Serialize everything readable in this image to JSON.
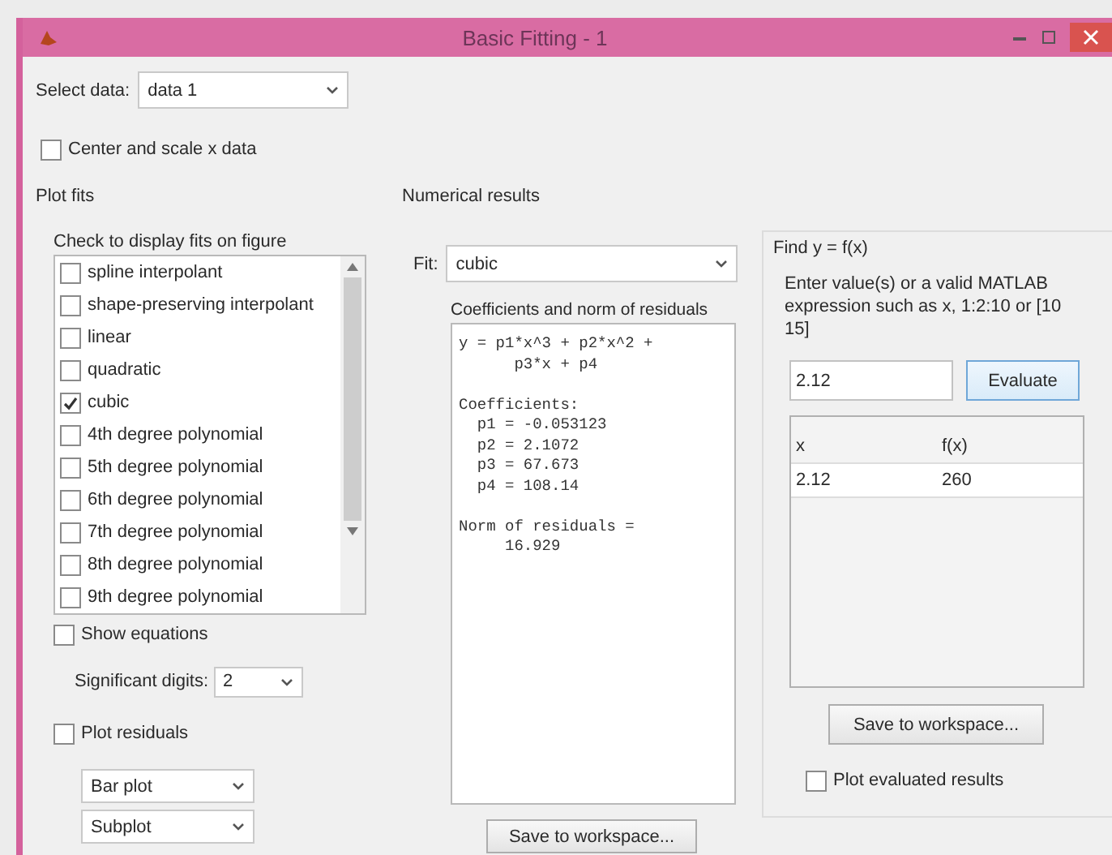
{
  "window": {
    "title": "Basic Fitting - 1"
  },
  "select_data": {
    "label": "Select data:",
    "value": "data 1"
  },
  "center_scale": {
    "label": "Center and scale x data",
    "checked": false
  },
  "plot_fits": {
    "title": "Plot fits",
    "hint": "Check to display fits on figure",
    "fits": [
      {
        "label": "spline interpolant",
        "checked": false
      },
      {
        "label": "shape-preserving interpolant",
        "checked": false
      },
      {
        "label": "linear",
        "checked": false
      },
      {
        "label": "quadratic",
        "checked": false
      },
      {
        "label": "cubic",
        "checked": true
      },
      {
        "label": "4th degree polynomial",
        "checked": false
      },
      {
        "label": "5th degree polynomial",
        "checked": false
      },
      {
        "label": "6th degree polynomial",
        "checked": false
      },
      {
        "label": "7th degree polynomial",
        "checked": false
      },
      {
        "label": "8th degree polynomial",
        "checked": false
      },
      {
        "label": "9th degree polynomial",
        "checked": false
      }
    ],
    "show_equations": {
      "label": "Show equations",
      "checked": false
    },
    "significant_digits": {
      "label": "Significant digits:",
      "value": "2"
    },
    "plot_residuals": {
      "label": "Plot residuals",
      "checked": false
    },
    "residual_plot_type": "Bar plot",
    "residual_location": "Subplot"
  },
  "numerical_results": {
    "title": "Numerical results",
    "fit": {
      "label": "Fit:",
      "value": "cubic"
    },
    "coefficients": {
      "title": "Coefficients and norm of residuals",
      "text": "y = p1*x^3 + p2*x^2 +\n      p3*x + p4\n\nCoefficients:\n  p1 = -0.053123\n  p2 = 2.1072\n  p3 = 67.673\n  p4 = 108.14\n\nNorm of residuals =\n     16.929"
    },
    "save_button": "Save to workspace..."
  },
  "find": {
    "title": "Find y = f(x)",
    "instructions": "Enter value(s) or a valid MATLAB expression such as x, 1:2:10 or [10 15]",
    "input": "2.12",
    "evaluate_button": "Evaluate",
    "table": {
      "columns": [
        "x",
        "f(x)"
      ],
      "rows": [
        [
          "2.12",
          "260"
        ]
      ]
    },
    "save_button": "Save to workspace...",
    "plot_evaluated": {
      "label": "Plot evaluated results",
      "checked": false
    }
  }
}
